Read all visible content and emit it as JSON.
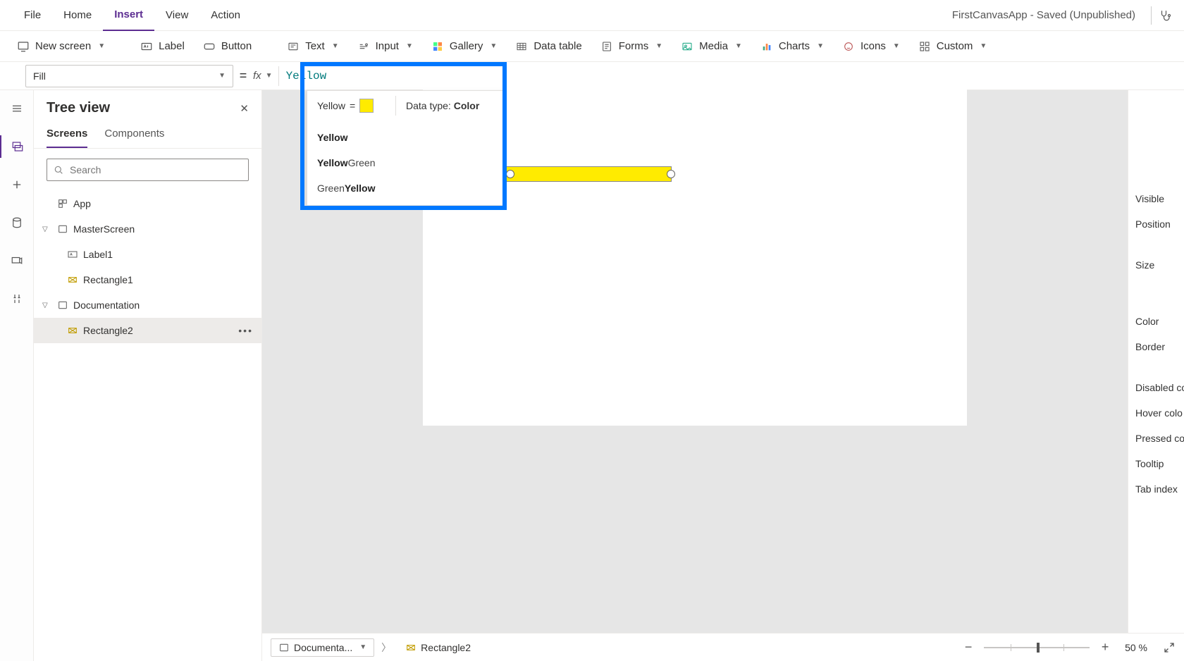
{
  "app_title": "FirstCanvasApp - Saved (Unpublished)",
  "menubar": {
    "items": [
      "File",
      "Home",
      "Insert",
      "View",
      "Action"
    ],
    "active_index": 2
  },
  "ribbon": {
    "new_screen": "New screen",
    "label": "Label",
    "button": "Button",
    "text": "Text",
    "input": "Input",
    "gallery": "Gallery",
    "data_table": "Data table",
    "forms": "Forms",
    "media": "Media",
    "charts": "Charts",
    "icons": "Icons",
    "custom": "Custom"
  },
  "formula": {
    "property": "Fill",
    "value": "Yellow"
  },
  "autocomplete": {
    "preview_name": "Yellow",
    "preview_swatch": "#ffeb00",
    "datatype_label": "Data type:",
    "datatype_value": "Color",
    "items": [
      {
        "pre": "",
        "match": "Yellow",
        "post": ""
      },
      {
        "pre": "",
        "match": "Yellow",
        "post": "Green"
      },
      {
        "pre": "Green",
        "match": "Yellow",
        "post": ""
      }
    ]
  },
  "tree": {
    "title": "Tree view",
    "tabs": {
      "screens": "Screens",
      "components": "Components"
    },
    "search_placeholder": "Search",
    "app_node": "App",
    "nodes": [
      {
        "kind": "screen",
        "label": "MasterScreen",
        "expanded": true,
        "children": [
          {
            "kind": "label",
            "label": "Label1"
          },
          {
            "kind": "rect",
            "label": "Rectangle1"
          }
        ]
      },
      {
        "kind": "screen",
        "label": "Documentation",
        "expanded": true,
        "children": [
          {
            "kind": "rect",
            "label": "Rectangle2",
            "selected": true
          }
        ]
      }
    ]
  },
  "canvas": {
    "selected_rect_fill": "#ffeb00"
  },
  "props": {
    "items": [
      "Visible",
      "Position",
      "Size",
      "",
      "Color",
      "Border",
      "",
      "Disabled co",
      "Hover colo",
      "Pressed co",
      "Tooltip",
      "Tab index"
    ]
  },
  "statusbar": {
    "crumb1": "Documenta...",
    "crumb2": "Rectangle2",
    "zoom_value": "50",
    "zoom_pct": "%"
  }
}
